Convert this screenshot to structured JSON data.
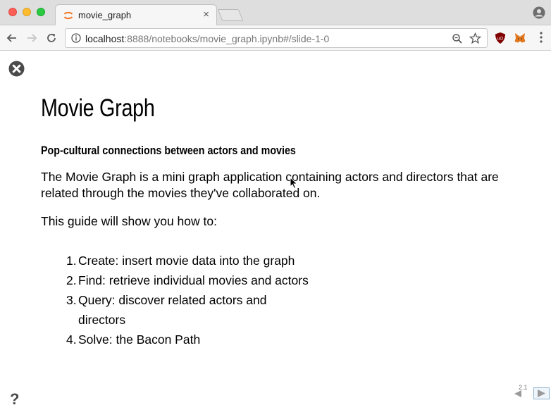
{
  "window": {
    "traffic_lights": [
      "close",
      "minimize",
      "zoom"
    ]
  },
  "tab": {
    "title": "movie_graph",
    "close_glyph": "×",
    "favicon": "jupyter-icon"
  },
  "toolbar": {
    "url_host": "localhost",
    "url_rest": ":8888/notebooks/movie_graph.ipynb#/slide-1-0",
    "icons": [
      "back-icon",
      "forward-icon",
      "reload-icon",
      "info-icon",
      "zoom-icon",
      "star-icon",
      "ublock-icon",
      "metamask-icon",
      "menu-icon"
    ]
  },
  "slide": {
    "title": "Movie Graph",
    "subtitle": "Pop-cultural connections between actors and movies",
    "intro": "The Movie Graph is a mini graph application containing actors and directors that are related through the movies they've collaborated on.",
    "guide_lead": "This guide will show you how to:",
    "steps": [
      {
        "num": "1.",
        "text": "Create: insert movie data into the graph"
      },
      {
        "num": "2.",
        "text": "Find: retrieve individual movies and actors"
      },
      {
        "num": "3.",
        "text": "Query: discover related actors and directors"
      },
      {
        "num": "4.",
        "text": "Solve: the Bacon Path"
      }
    ],
    "help_glyph": "?",
    "slide_number": "2.1"
  },
  "colors": {
    "jupyter_orange": "#f37726",
    "close_red": "#fc5f57",
    "minimize_yellow": "#fdbc2e",
    "zoom_green": "#29c940",
    "ublock_red": "#800000",
    "metamask_orange": "#e2761b"
  }
}
